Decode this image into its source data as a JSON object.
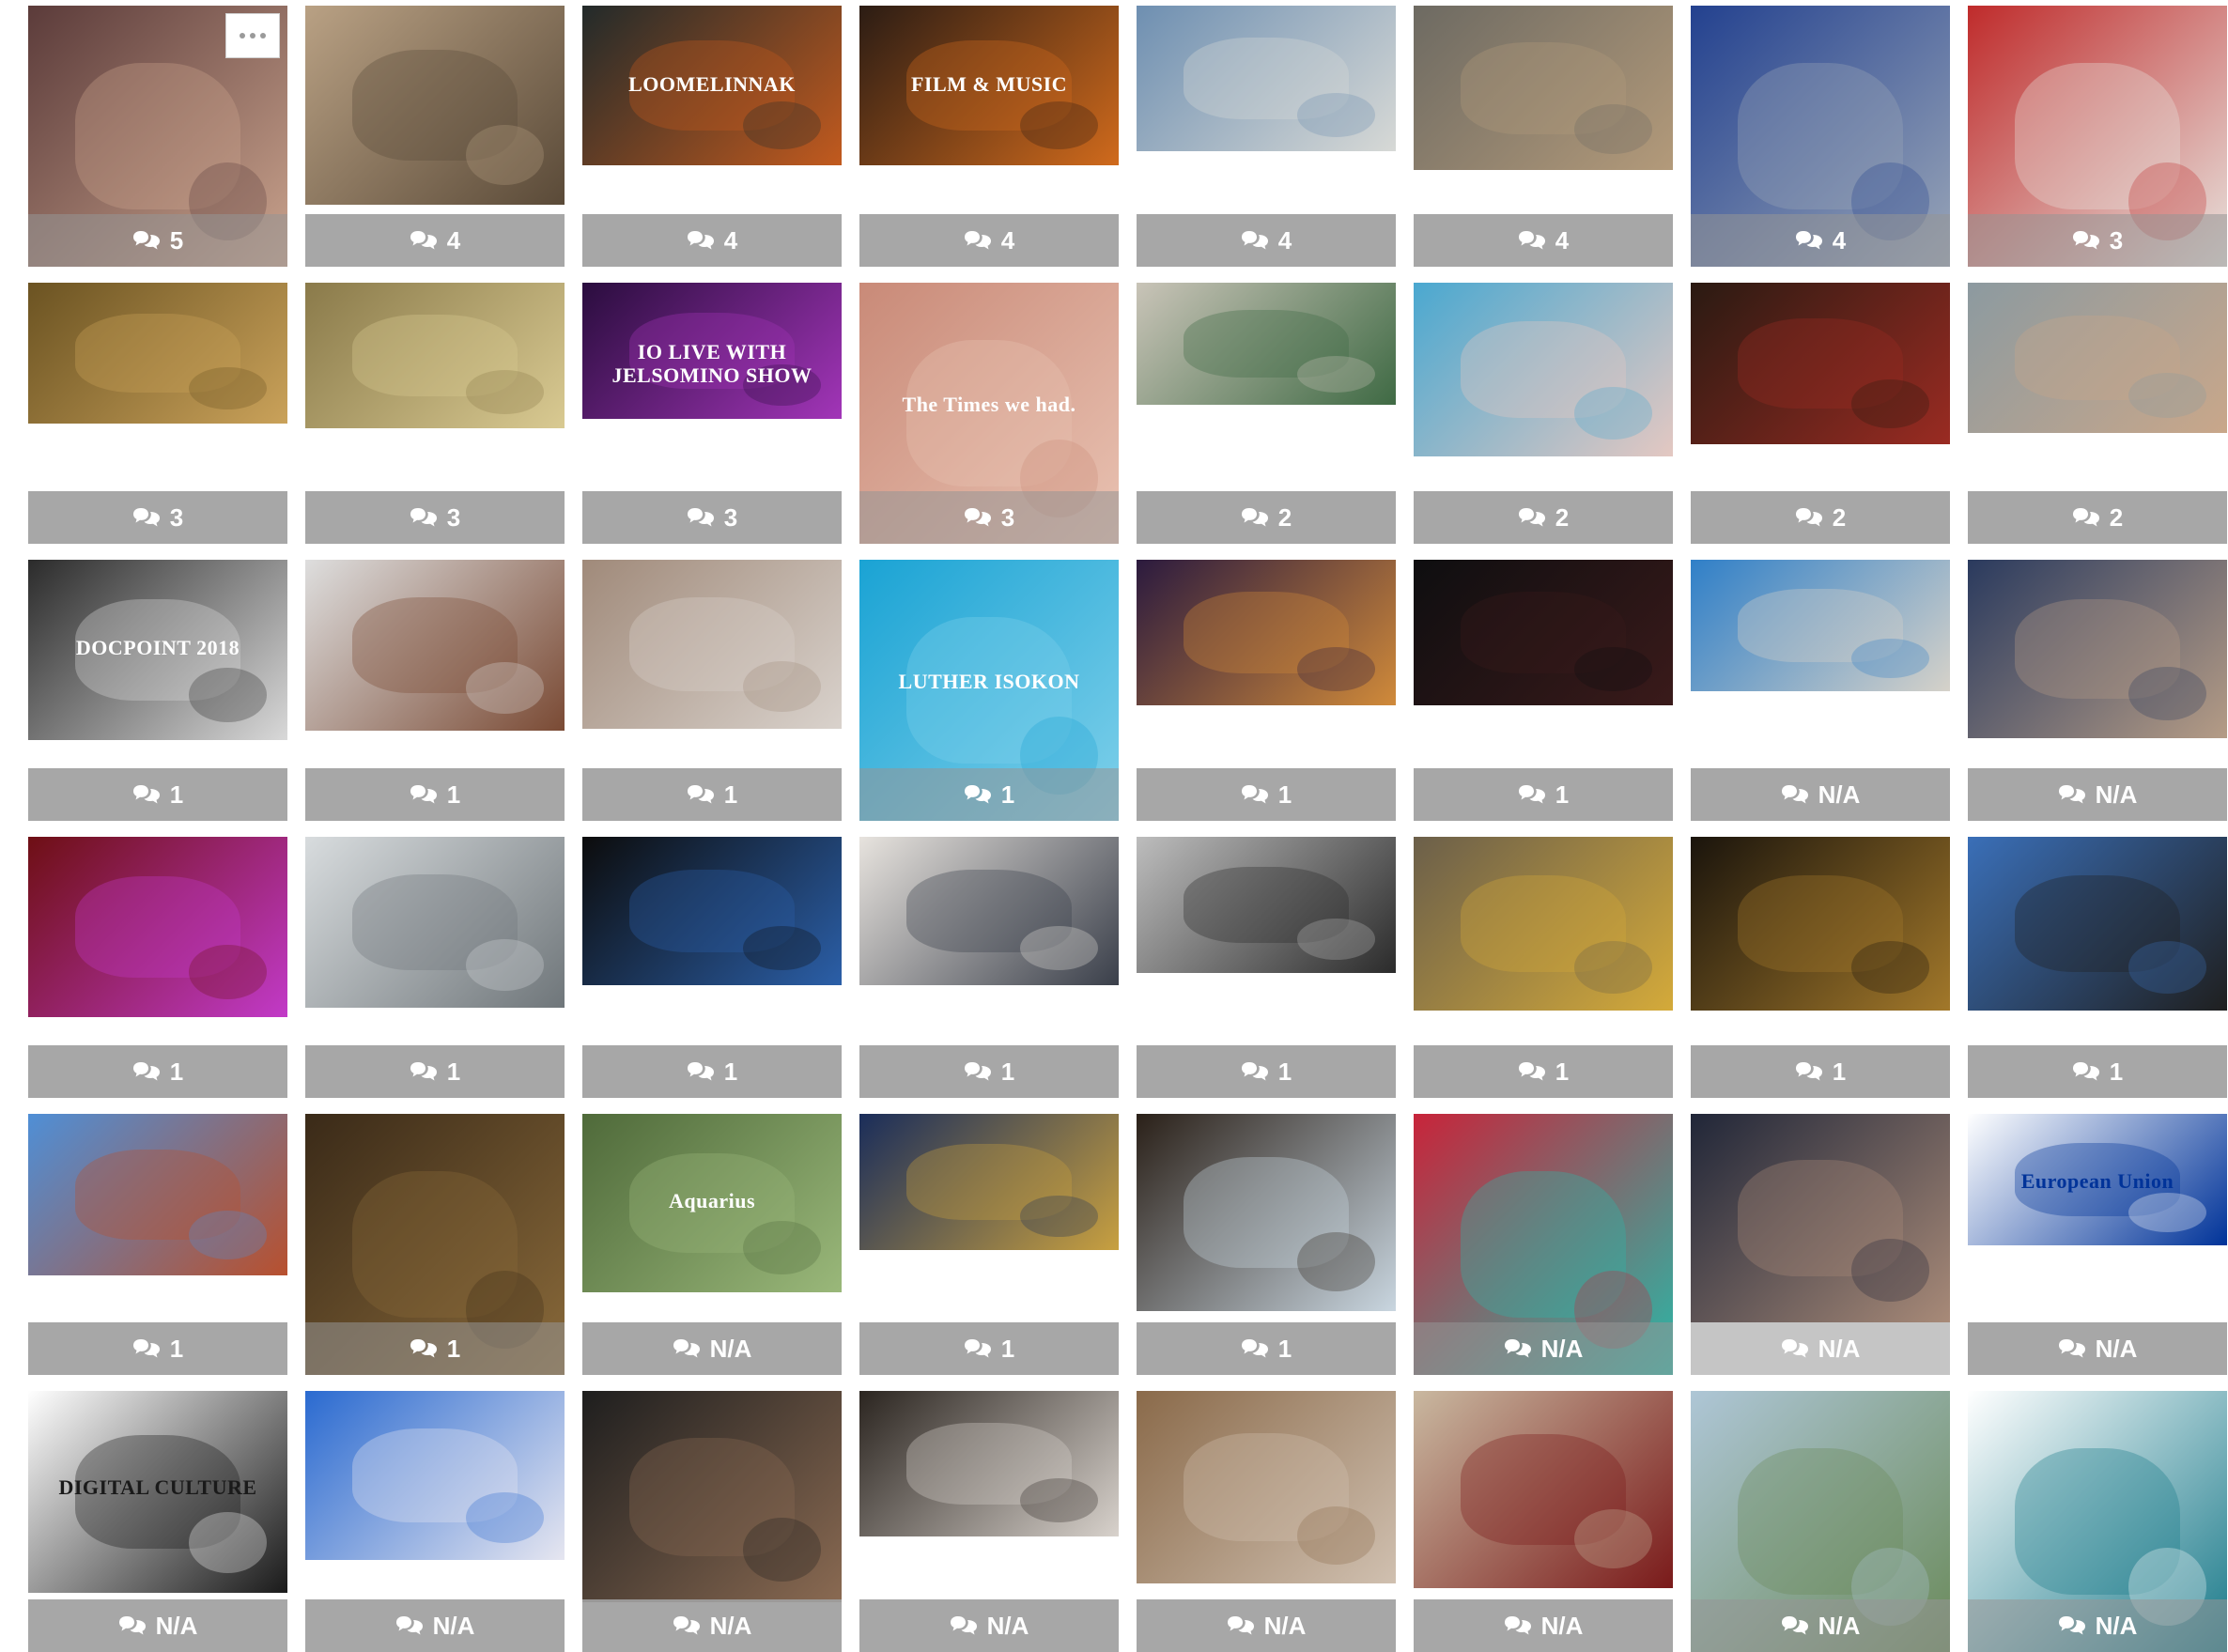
{
  "gallery": {
    "more_button_icon": "ellipsis-icon",
    "comment_icon": "comment-bubbles-icon",
    "tiles": [
      {
        "count": "5",
        "colors": [
          "#5b3b3a",
          "#caa38d"
        ],
        "caption": ""
      },
      {
        "count": "4",
        "colors": [
          "#b9a184",
          "#5a4a38"
        ],
        "caption": ""
      },
      {
        "count": "4",
        "colors": [
          "#222a2a",
          "#c25a1e"
        ],
        "caption": "LOOMELINNAK"
      },
      {
        "count": "4",
        "colors": [
          "#2b1c14",
          "#d06a1c"
        ],
        "caption": "FILM & MUSIC"
      },
      {
        "count": "4",
        "colors": [
          "#6e8fb1",
          "#d7d9d6"
        ],
        "caption": ""
      },
      {
        "count": "4",
        "colors": [
          "#6d6a62",
          "#b39a7a"
        ],
        "caption": ""
      },
      {
        "count": "4",
        "colors": [
          "#23418f",
          "#9aa6b8"
        ],
        "caption": ""
      },
      {
        "count": "3",
        "colors": [
          "#bf2b2b",
          "#e8e3de"
        ],
        "caption": ""
      },
      {
        "count": "3",
        "colors": [
          "#6b5322",
          "#caa25a"
        ],
        "caption": ""
      },
      {
        "count": "3",
        "colors": [
          "#8a7a4a",
          "#d9ca92"
        ],
        "caption": ""
      },
      {
        "count": "3",
        "colors": [
          "#2a0d3e",
          "#a235b8"
        ],
        "caption": "IO LIVE WITH JELSOMINO SHOW"
      },
      {
        "count": "3",
        "colors": [
          "#c98a78",
          "#e9c2b2"
        ],
        "caption": "The Times we had."
      },
      {
        "count": "2",
        "colors": [
          "#c9c4b8",
          "#3f6a44"
        ],
        "caption": ""
      },
      {
        "count": "2",
        "colors": [
          "#4aa8d0",
          "#e4c8c2"
        ],
        "caption": ""
      },
      {
        "count": "2",
        "colors": [
          "#2a1a12",
          "#9a2b22"
        ],
        "caption": ""
      },
      {
        "count": "2",
        "colors": [
          "#8c9aa0",
          "#c9a78a"
        ],
        "caption": ""
      },
      {
        "count": "1",
        "colors": [
          "#2b2b2b",
          "#d9d9d9"
        ],
        "caption": "DOCPOINT 2018"
      },
      {
        "count": "1",
        "colors": [
          "#dedede",
          "#7a4a34"
        ],
        "caption": ""
      },
      {
        "count": "1",
        "colors": [
          "#a08a7a",
          "#d9d2cc"
        ],
        "caption": ""
      },
      {
        "count": "1",
        "colors": [
          "#1aa3d4",
          "#7fd0ea"
        ],
        "caption": "LUTHER ISOKON"
      },
      {
        "count": "1",
        "colors": [
          "#2b1a3e",
          "#d08a3a"
        ],
        "caption": ""
      },
      {
        "count": "1",
        "colors": [
          "#0e0e10",
          "#3a1a1a"
        ],
        "caption": ""
      },
      {
        "count": "N/A",
        "colors": [
          "#2f7fc8",
          "#d6d2c9"
        ],
        "caption": ""
      },
      {
        "count": "N/A",
        "colors": [
          "#2a3a5e",
          "#b59c86"
        ],
        "caption": ""
      },
      {
        "count": "1",
        "colors": [
          "#6e0f14",
          "#c23ac8"
        ],
        "caption": ""
      },
      {
        "count": "1",
        "colors": [
          "#d8dcde",
          "#6f767a"
        ],
        "caption": ""
      },
      {
        "count": "1",
        "colors": [
          "#0c0c0c",
          "#2b5fa8"
        ],
        "caption": ""
      },
      {
        "count": "1",
        "colors": [
          "#e7e3de",
          "#3a3f4a"
        ],
        "caption": ""
      },
      {
        "count": "1",
        "colors": [
          "#bdbdbd",
          "#2b2b2b"
        ],
        "caption": ""
      },
      {
        "count": "1",
        "colors": [
          "#6b5f4a",
          "#d4aa3a"
        ],
        "caption": ""
      },
      {
        "count": "1",
        "colors": [
          "#1a140c",
          "#a2782a"
        ],
        "caption": ""
      },
      {
        "count": "1",
        "colors": [
          "#3a6fb8",
          "#1f1f1f"
        ],
        "caption": ""
      },
      {
        "count": "1",
        "colors": [
          "#4f8fd6",
          "#b8502e"
        ],
        "caption": ""
      },
      {
        "count": "1",
        "colors": [
          "#3a2a18",
          "#8a6a3a"
        ],
        "caption": ""
      },
      {
        "count": "N/A",
        "colors": [
          "#4f6a3a",
          "#9ab87a"
        ],
        "caption": "Aquarius"
      },
      {
        "count": "1",
        "colors": [
          "#1a2d5a",
          "#c8a040"
        ],
        "caption": ""
      },
      {
        "count": "1",
        "colors": [
          "#2a2018",
          "#c9d6e0"
        ],
        "caption": ""
      },
      {
        "count": "N/A",
        "colors": [
          "#c8243a",
          "#2ab8a8"
        ],
        "caption": ""
      },
      {
        "count": "N/A",
        "colors": [
          "#202638",
          "#a88a78"
        ],
        "caption": ""
      },
      {
        "count": "N/A",
        "colors": [
          "#ffffff",
          "#003399"
        ],
        "caption": "European Union"
      },
      {
        "count": "N/A",
        "colors": [
          "#ffffff",
          "#1a1a1a"
        ],
        "caption": "DIGITAL CULTURE"
      },
      {
        "count": "N/A",
        "colors": [
          "#2a6ad0",
          "#e6e6f0"
        ],
        "caption": ""
      },
      {
        "count": "N/A",
        "colors": [
          "#1e1e1e",
          "#8a6a52"
        ],
        "caption": ""
      },
      {
        "count": "N/A",
        "colors": [
          "#2b2520",
          "#d8d2cc"
        ],
        "caption": ""
      },
      {
        "count": "N/A",
        "colors": [
          "#8a6a4a",
          "#d0c0b0"
        ],
        "caption": ""
      },
      {
        "count": "N/A",
        "colors": [
          "#c9b8a0",
          "#7a1a1a"
        ],
        "caption": ""
      },
      {
        "count": "N/A",
        "colors": [
          "#aec6d6",
          "#6a8a5a"
        ],
        "caption": ""
      },
      {
        "count": "N/A",
        "colors": [
          "#ffffff",
          "#1a7a8a"
        ],
        "caption": ""
      }
    ]
  }
}
